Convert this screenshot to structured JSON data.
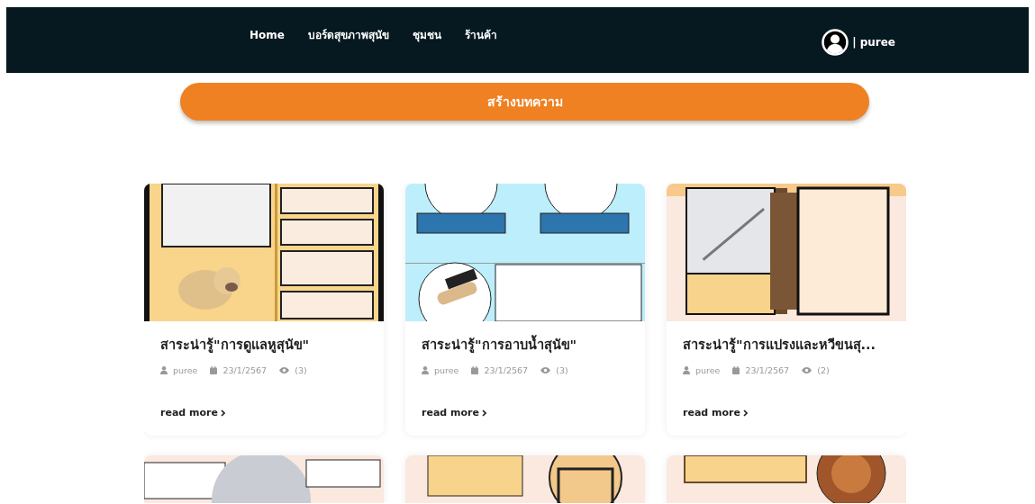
{
  "navbar": {
    "links": [
      {
        "label": "Home"
      },
      {
        "label": "บอร์ดสุขภาพสุนัข"
      },
      {
        "label": "ชุมชน"
      },
      {
        "label": "ร้านค้า"
      }
    ],
    "user": {
      "separator": "|",
      "name": "puree"
    }
  },
  "create_button": {
    "label": "สร้างบทความ"
  },
  "posts": [
    {
      "image": {
        "kind": "picture"
      },
      "title": "สาระน่ารู้\"การดูแลหูสุนัข\"",
      "author": "puree",
      "date": "23/1/2567",
      "views": "(3)",
      "read_more": "read more"
    },
    {
      "image": {
        "kind": "picture"
      },
      "title": "สาระน่ารู้\"การอาบน้ำสุนัข\"",
      "author": "puree",
      "date": "23/1/2567",
      "views": "(3)",
      "read_more": "read more"
    },
    {
      "image": {
        "kind": "picture"
      },
      "title": "สาระน่ารู้\"การแปรงและหวีขนสุ...",
      "author": "puree",
      "date": "23/1/2567",
      "views": "(2)",
      "read_more": "read more"
    },
    {
      "image": {
        "kind": "picture"
      }
    },
    {
      "image": {
        "kind": "picture"
      }
    },
    {
      "image": {
        "kind": "picture"
      }
    }
  ]
}
